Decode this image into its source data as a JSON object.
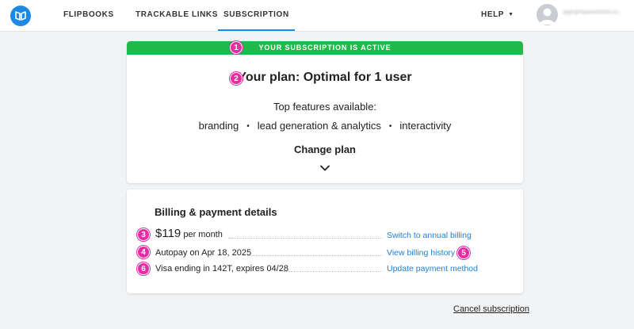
{
  "nav": {
    "tabs": [
      {
        "label": "FLIPBOOKS"
      },
      {
        "label": "TRACKABLE LINKS"
      },
      {
        "label": "SUBSCRIPTION"
      }
    ],
    "help_label": "HELP",
    "account_email": "spgm@heyteamkinrelo.co..."
  },
  "plan": {
    "status": "YOUR SUBSCRIPTION IS ACTIVE",
    "title": "Your plan: Optimal for 1 user",
    "features_heading": "Top features available:",
    "features": [
      "branding",
      "lead generation & analytics",
      "interactivity"
    ],
    "change_plan": "Change plan"
  },
  "billing": {
    "title": "Billing & payment details",
    "price": "$119",
    "price_period": "per month",
    "autopay": "Autopay on Apr 18, 2025",
    "card": "Visa ending in 142T, expires 04/28",
    "switch_link": "Switch to annual billing",
    "history_link": "View billing history",
    "update_link": "Update payment method"
  },
  "cancel_label": "Cancel subscription",
  "badges": [
    "1",
    "2",
    "3",
    "4",
    "5",
    "6"
  ],
  "colors": {
    "accent": "#1e88e5",
    "active_green": "#1fba4c",
    "badge_magenta": "#e52ea3",
    "link": "#1e7fd6"
  },
  "icons": {
    "logo": "book-logo-icon",
    "help_caret": "caret-down-icon",
    "avatar": "user-avatar-icon",
    "expand": "chevron-down-icon"
  }
}
